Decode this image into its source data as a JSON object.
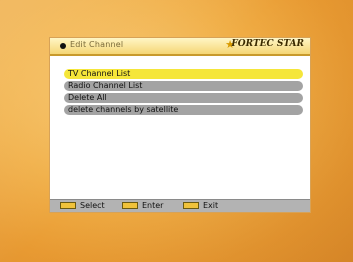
{
  "header": {
    "title": "Edit Channel",
    "brand": "FORTEC STAR"
  },
  "menu": {
    "items": [
      {
        "label": "TV Channel List",
        "selected": true
      },
      {
        "label": "Radio Channel List",
        "selected": false
      },
      {
        "label": "Delete All",
        "selected": false
      },
      {
        "label": "delete channels by satellite",
        "selected": false
      }
    ]
  },
  "footer": {
    "select_label": "Select",
    "enter_label": "Enter",
    "exit_label": "Exit"
  },
  "colors": {
    "background_orange": "#f0ad45",
    "selected_row": "#f5e63a",
    "row_gray": "#a3a3a3"
  }
}
